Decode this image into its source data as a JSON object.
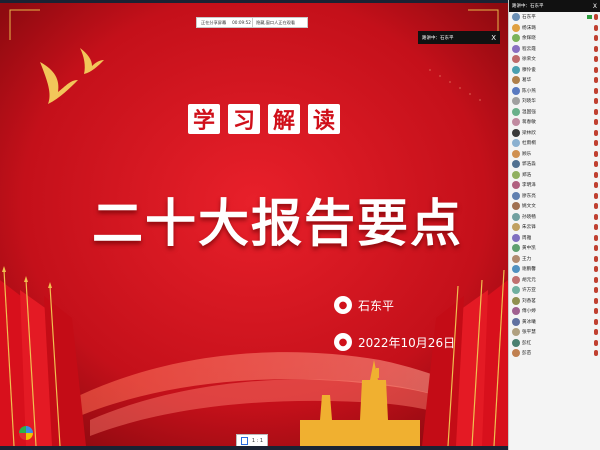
{
  "share_bar": {
    "status": "正在分享屏幕",
    "timer": "00:09:52",
    "hint": "隐藏,窗口人正在观看"
  },
  "popup": {
    "label": "路讲中：石东平",
    "close": "X"
  },
  "slide": {
    "tag_chars": [
      "学",
      "习",
      "解",
      "读"
    ],
    "headline": "二十大报告要点",
    "person": "石东平",
    "date": "2022年10月26日",
    "page_indicator": "1 : 1"
  },
  "panel": {
    "title": "路讲中：石东平",
    "close": "X",
    "users": [
      {
        "name": "石东平",
        "color": "#6a8fb5",
        "cam": true
      },
      {
        "name": "杨沫璐",
        "color": "#e0a040",
        "cam": false
      },
      {
        "name": "余辉晓",
        "color": "#7bb35a",
        "cam": false
      },
      {
        "name": "程云霞",
        "color": "#8a6fc0",
        "cam": false
      },
      {
        "name": "徐荣文",
        "color": "#c06a6a",
        "cam": false
      },
      {
        "name": "穆伶俊",
        "color": "#4aa0b0",
        "cam": false
      },
      {
        "name": "葛华",
        "color": "#b0804a",
        "cam": false
      },
      {
        "name": "陈小燕",
        "color": "#5a7ac0",
        "cam": false
      },
      {
        "name": "刘晓华",
        "color": "#a0a0a0",
        "cam": false
      },
      {
        "name": "温国强",
        "color": "#6ab08a",
        "cam": false
      },
      {
        "name": "蒋春敏",
        "color": "#c08aa0",
        "cam": false
      },
      {
        "name": "梁林欣",
        "color": "#3a3a3a",
        "cam": false
      },
      {
        "name": "杜雨桐",
        "color": "#8ab0d0",
        "cam": false
      },
      {
        "name": "顾乐",
        "color": "#d09050",
        "cam": false
      },
      {
        "name": "郭浩淼",
        "color": "#507090",
        "cam": false
      },
      {
        "name": "郑浩",
        "color": "#90b060",
        "cam": false
      },
      {
        "name": "李明泽",
        "color": "#b06080",
        "cam": false
      },
      {
        "name": "廖东亮",
        "color": "#6080b0",
        "cam": false
      },
      {
        "name": "姚文文",
        "color": "#a07050",
        "cam": false
      },
      {
        "name": "孙晓畅",
        "color": "#70a0a0",
        "cam": false
      },
      {
        "name": "朱云锋",
        "color": "#c0a060",
        "cam": false
      },
      {
        "name": "周雅",
        "color": "#8070c0",
        "cam": false
      },
      {
        "name": "黄中凯",
        "color": "#60a070",
        "cam": false
      },
      {
        "name": "王力",
        "color": "#b08a70",
        "cam": false
      },
      {
        "name": "谢鹏馨",
        "color": "#5090c0",
        "cam": false
      },
      {
        "name": "胡元元",
        "color": "#c07070",
        "cam": false
      },
      {
        "name": "许方亚",
        "color": "#70b0a0",
        "cam": false
      },
      {
        "name": "刘香茗",
        "color": "#909050",
        "cam": false
      },
      {
        "name": "傅小婷",
        "color": "#a06090",
        "cam": false
      },
      {
        "name": "黄冰曦",
        "color": "#6070a0",
        "cam": false
      },
      {
        "name": "张平慧",
        "color": "#b0a080",
        "cam": false
      },
      {
        "name": "彭红",
        "color": "#4a8070",
        "cam": false
      },
      {
        "name": "彭苗",
        "color": "#c08050",
        "cam": false
      }
    ]
  }
}
